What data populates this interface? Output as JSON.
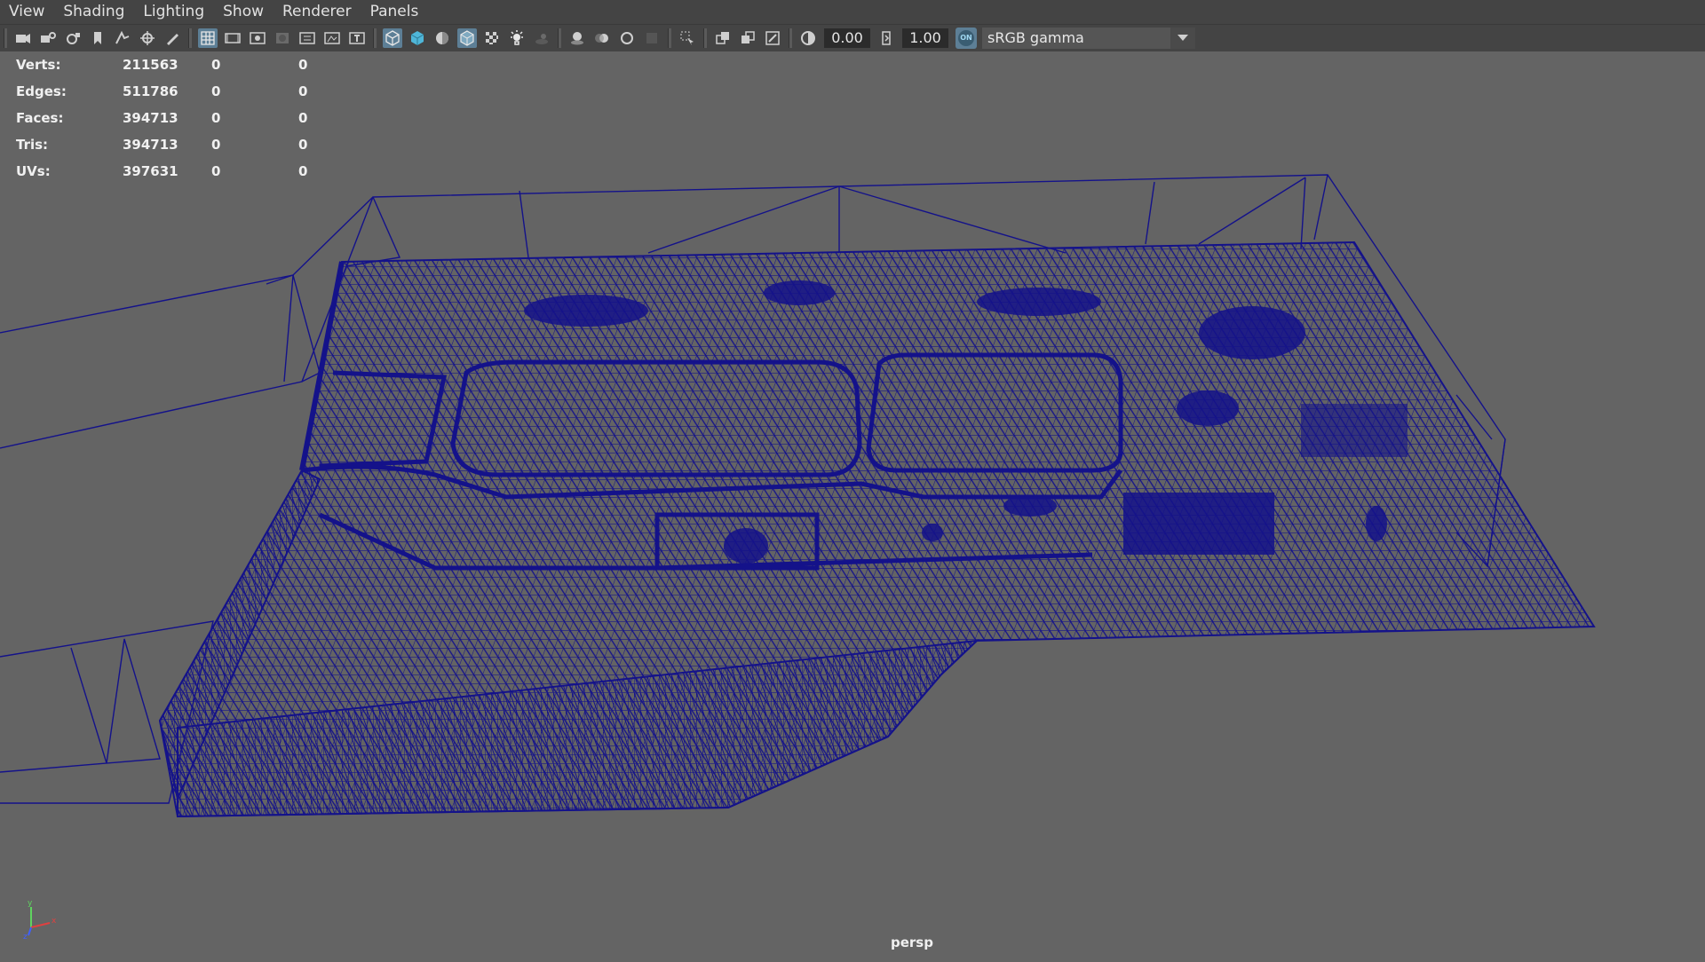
{
  "menu": {
    "items": [
      "View",
      "Shading",
      "Lighting",
      "Show",
      "Renderer",
      "Panels"
    ]
  },
  "toolbar": {
    "exposure": "0.00",
    "gamma": "1.00",
    "colorspace": "sRGB gamma",
    "colormanage_badge": "ON",
    "icons_left": [
      "camera-icon",
      "camera-attribute-icon",
      "camera-bookmark-icon",
      "bookmark-icon",
      "image-plane-icon",
      "2d-pan-icon",
      "grease-pencil-icon"
    ],
    "icons_mid": [
      "grid-icon",
      "film-gate-icon",
      "resolution-gate-icon",
      "gate-mask-icon",
      "field-chart-icon",
      "safe-action-icon",
      "safe-title-icon"
    ],
    "icons_shading": [
      "wireframe-icon",
      "smooth-shade-icon",
      "default-material-icon",
      "wireframe-on-shaded-icon",
      "textured-icon",
      "use-all-lights-icon",
      "shadows-icon"
    ],
    "icons_render": [
      "screen-space-ao-icon",
      "motion-blur-icon",
      "anti-aliasing-icon",
      "depth-of-field-icon"
    ],
    "icons_iso": [
      "isolate-select-icon"
    ],
    "icons_xray": [
      "xray-icon",
      "xray-active-icon",
      "xray-joints-icon"
    ],
    "icons_tail": [
      "exposure-icon",
      "gamma-icon"
    ]
  },
  "heads_up": {
    "rows": [
      {
        "label": "Verts:",
        "value": "211563",
        "sel": "0",
        "comp": "0"
      },
      {
        "label": "Edges:",
        "value": "511786",
        "sel": "0",
        "comp": "0"
      },
      {
        "label": "Faces:",
        "value": "394713",
        "sel": "0",
        "comp": "0"
      },
      {
        "label": "Tris:",
        "value": "394713",
        "sel": "0",
        "comp": "0"
      },
      {
        "label": "UVs:",
        "value": "397631",
        "sel": "0",
        "comp": "0"
      }
    ]
  },
  "viewport": {
    "camera": "persp",
    "wire_color": "#14128a",
    "bg_color": "#646464",
    "axis": {
      "x": "x",
      "y": "y",
      "z": "z"
    }
  }
}
